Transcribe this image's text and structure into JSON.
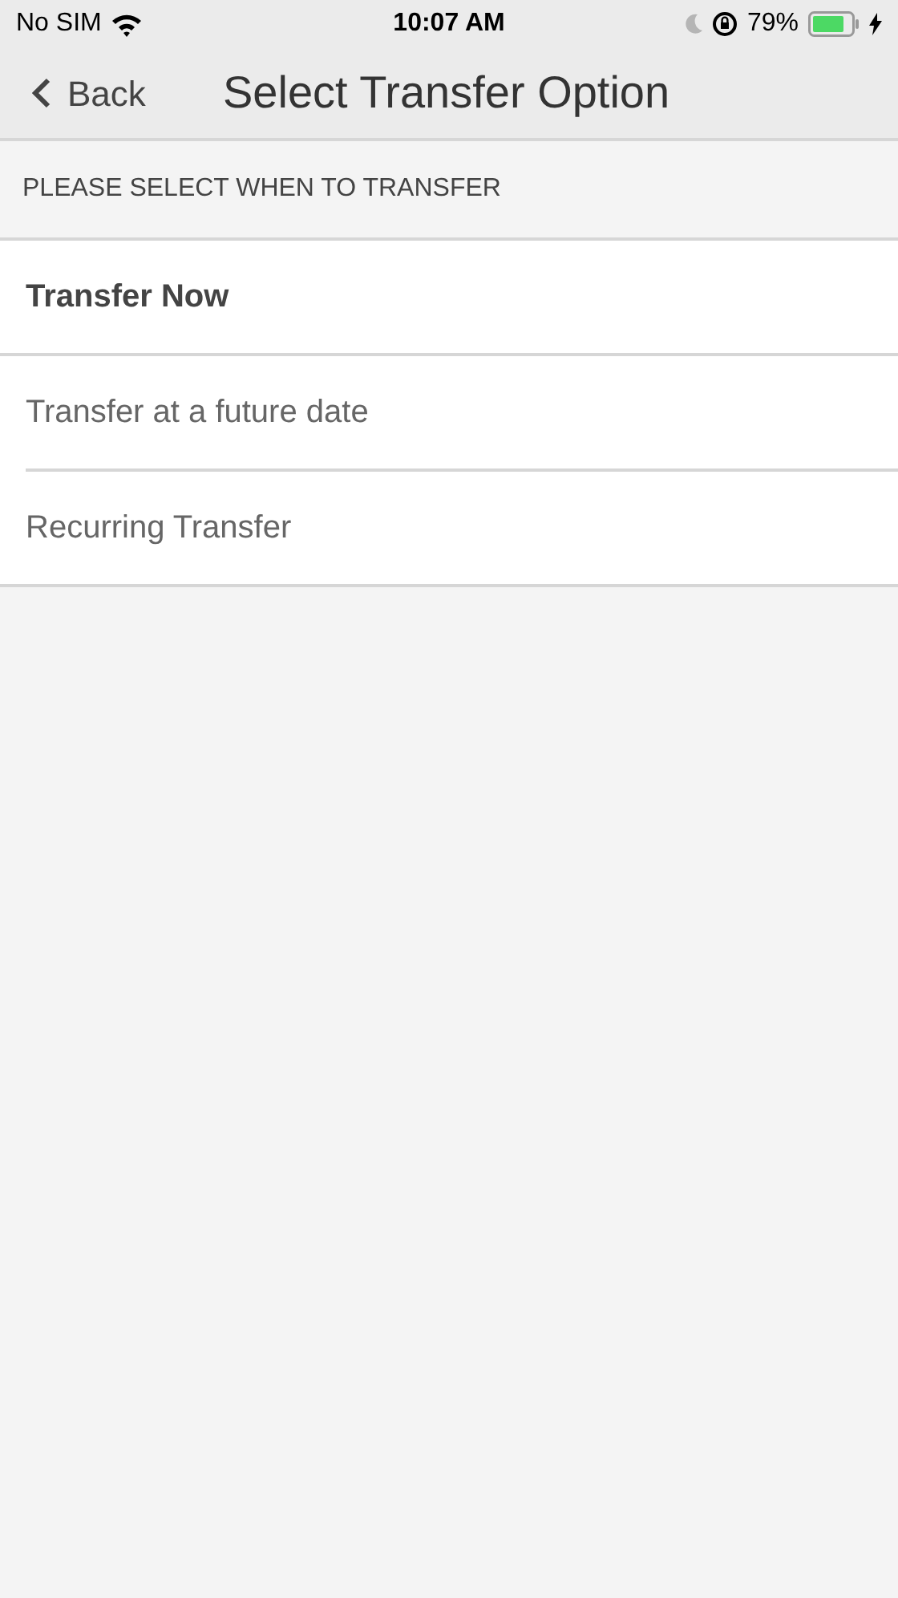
{
  "status_bar": {
    "carrier": "No SIM",
    "time": "10:07 AM",
    "battery": "79%"
  },
  "nav": {
    "back": "Back",
    "title": "Select Transfer Option"
  },
  "section": {
    "header": "PLEASE SELECT WHEN TO TRANSFER"
  },
  "options": [
    {
      "label": "Transfer Now",
      "selected": true
    },
    {
      "label": "Transfer at a future date",
      "selected": false
    },
    {
      "label": "Recurring Transfer",
      "selected": false
    }
  ]
}
